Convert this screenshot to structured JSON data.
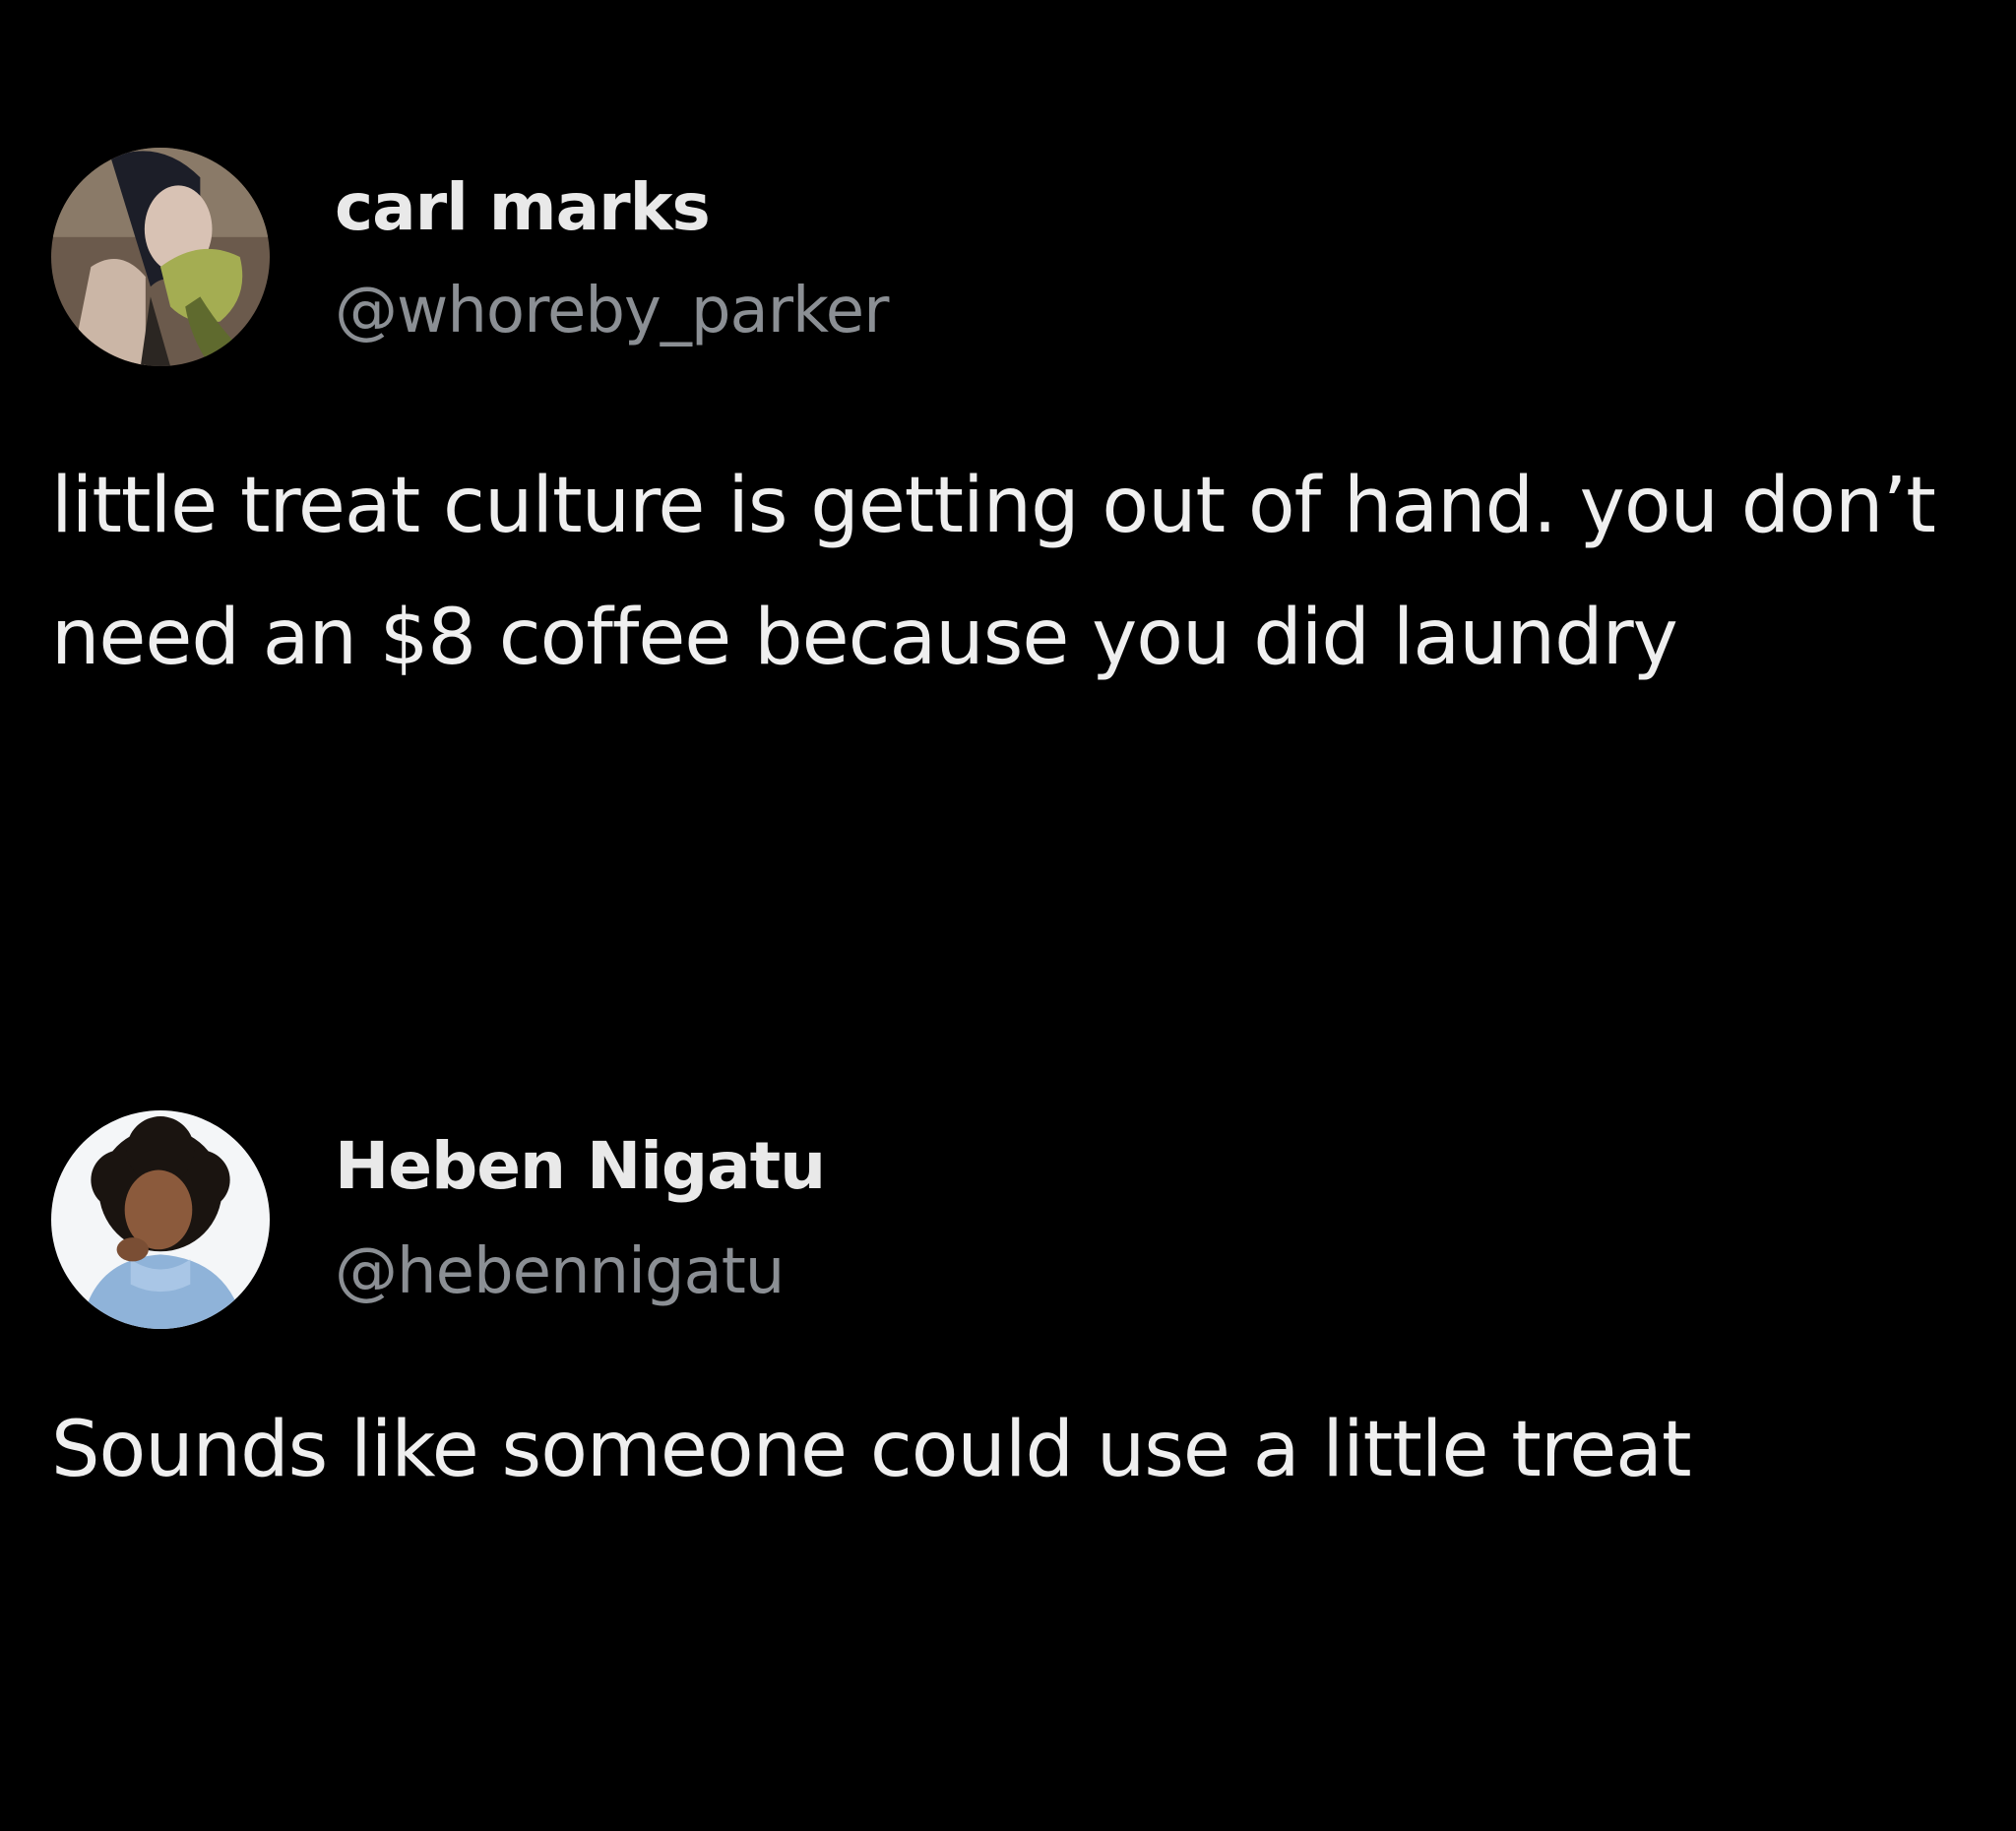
{
  "tweets": [
    {
      "display_name": "carl marks",
      "handle": "@whoreby_parker",
      "text": "little treat culture is getting out of hand. you don’t need an $8 coffee because you did laundry"
    },
    {
      "display_name": "Heben Nigatu",
      "handle": "@hebennigatu",
      "text": "Sounds like someone could use a little treat"
    }
  ],
  "colors": {
    "background": "#000000",
    "display_name": "#e9e9e9",
    "handle": "#8b8f94",
    "body_text": "#efefef"
  }
}
